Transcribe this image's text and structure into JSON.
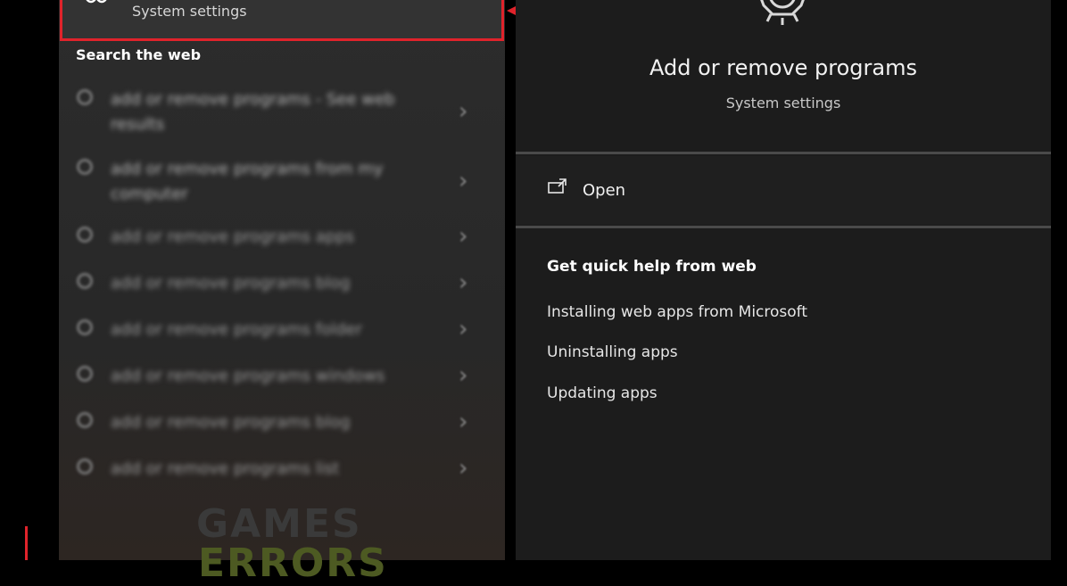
{
  "best_match": {
    "subtitle": "System settings",
    "icon": "apps-icon"
  },
  "search_web": {
    "heading": "Search the web",
    "items": [
      {
        "text": "add or remove programs - See web results"
      },
      {
        "text": "add or remove programs from my computer"
      },
      {
        "text": "add or remove programs apps"
      },
      {
        "text": "add or remove programs blog"
      },
      {
        "text": "add or remove programs folder"
      },
      {
        "text": "add or remove programs windows"
      },
      {
        "text": "add or remove programs blog"
      },
      {
        "text": "add or remove programs list"
      }
    ]
  },
  "detail": {
    "icon": "gear-icon",
    "title": "Add or remove programs",
    "subtitle": "System settings",
    "open_label": "Open",
    "help_heading": "Get quick help from web",
    "help_links": [
      {
        "label": "Installing web apps from Microsoft"
      },
      {
        "label": "Uninstalling apps"
      },
      {
        "label": "Updating apps"
      }
    ]
  },
  "watermark": {
    "line1": "GAMES",
    "line2": "ERRORS"
  },
  "colors": {
    "highlight": "#e0232b",
    "pane_left": "#2c2c2c",
    "pane_right": "#1c1c1c"
  }
}
